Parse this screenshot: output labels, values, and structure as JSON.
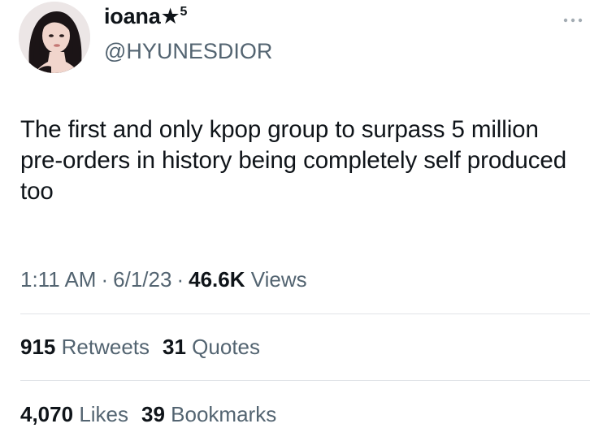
{
  "author": {
    "display_name": "ioana★",
    "display_name_sup": "5",
    "handle": "@HYUNESDIOR",
    "avatar_icon": "profile-photo-avatar"
  },
  "tweet": {
    "text": "The first and only kpop group to surpass 5 million pre-orders in history being completely self produced too"
  },
  "meta": {
    "time": "1:11 AM",
    "separator": "·",
    "date": "6/1/23",
    "views_count": "46.6K",
    "views_label": "Views"
  },
  "stats_row_1": {
    "retweets_count": "915",
    "retweets_label": "Retweets",
    "quotes_count": "31",
    "quotes_label": "Quotes"
  },
  "stats_row_2": {
    "likes_count": "4,070",
    "likes_label": "Likes",
    "bookmarks_count": "39",
    "bookmarks_label": "Bookmarks"
  },
  "colors": {
    "text_primary": "#0f1419",
    "text_secondary": "#536471",
    "divider": "#e1e4e8"
  },
  "icons": {
    "more": "more-horizontal-icon"
  }
}
